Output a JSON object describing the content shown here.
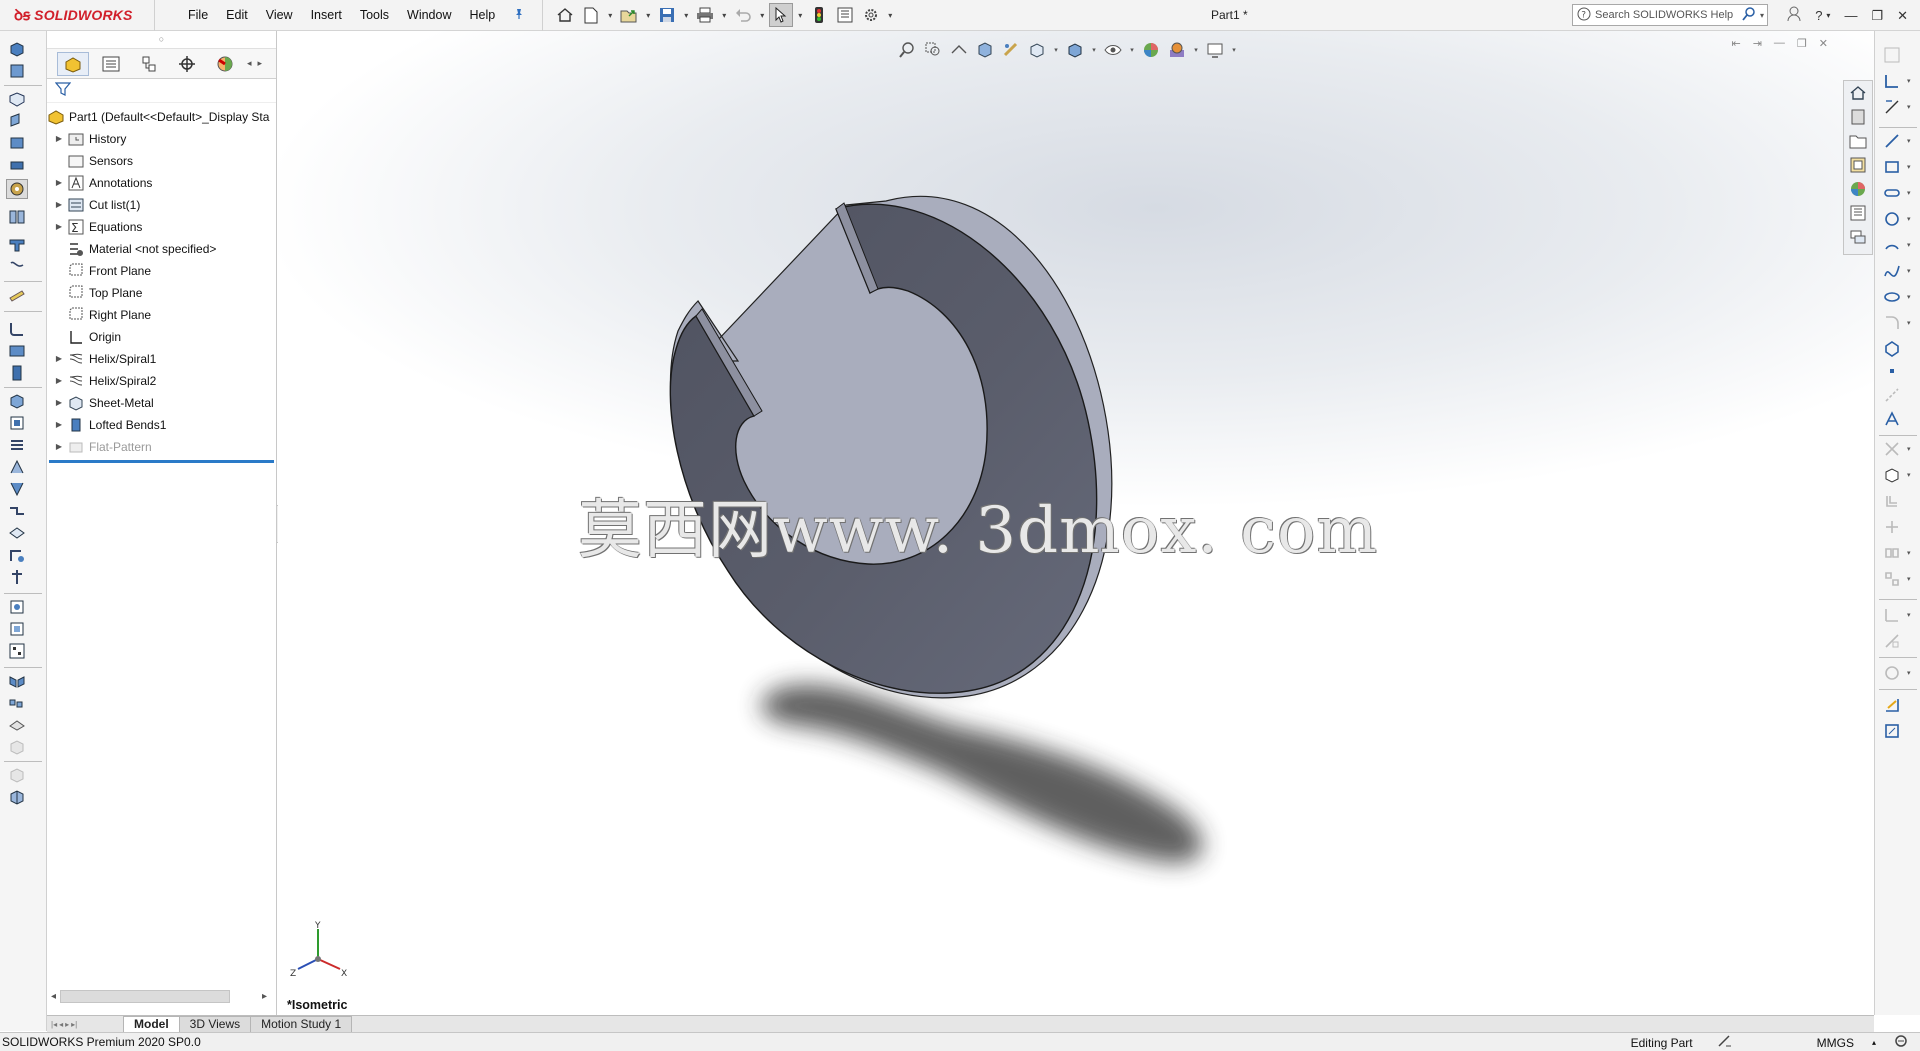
{
  "app": {
    "brand_prefix": "3S",
    "brand_name": "SOLIDWORKS",
    "document_title": "Part1 *"
  },
  "menu": [
    "File",
    "Edit",
    "View",
    "Insert",
    "Tools",
    "Window",
    "Help"
  ],
  "search": {
    "placeholder": "Search SOLIDWORKS Help"
  },
  "feature_tree": {
    "root_label": "Part1  (Default<<Default>_Display Sta",
    "items": [
      {
        "label": "History",
        "icon": "history-folder-icon",
        "expandable": true
      },
      {
        "label": "Sensors",
        "icon": "sensors-icon",
        "expandable": false
      },
      {
        "label": "Annotations",
        "icon": "annotations-icon",
        "expandable": true
      },
      {
        "label": "Cut list(1)",
        "icon": "cut-list-icon",
        "expandable": true
      },
      {
        "label": "Equations",
        "icon": "equations-icon",
        "expandable": true
      },
      {
        "label": "Material <not specified>",
        "icon": "material-icon",
        "expandable": false
      },
      {
        "label": "Front Plane",
        "icon": "plane-icon",
        "expandable": false
      },
      {
        "label": "Top Plane",
        "icon": "plane-icon",
        "expandable": false
      },
      {
        "label": "Right Plane",
        "icon": "plane-icon",
        "expandable": false
      },
      {
        "label": "Origin",
        "icon": "origin-icon",
        "expandable": false
      },
      {
        "label": "Helix/Spiral1",
        "icon": "helix-icon",
        "expandable": true
      },
      {
        "label": "Helix/Spiral2",
        "icon": "helix-icon",
        "expandable": true
      },
      {
        "label": "Sheet-Metal",
        "icon": "sheet-metal-icon",
        "expandable": true
      },
      {
        "label": "Lofted Bends1",
        "icon": "lofted-bends-icon",
        "expandable": true
      },
      {
        "label": "Flat-Pattern",
        "icon": "flat-pattern-icon",
        "expandable": true,
        "suppressed": true
      }
    ]
  },
  "viewport": {
    "watermark": "莫西网www. 3dmox. com",
    "view_name": "*Isometric",
    "triad": {
      "x": "X",
      "y": "Y",
      "z": "Z"
    }
  },
  "bottom_tabs": [
    "Model",
    "3D Views",
    "Motion Study 1"
  ],
  "status": {
    "product": "SOLIDWORKS Premium 2020 SP0.0",
    "mode": "Editing Part",
    "units": "MMGS"
  },
  "colors": {
    "brand_red": "#d11f2a",
    "part_body": "#5a5d6b",
    "selection_blue": "#2a7ac8"
  }
}
